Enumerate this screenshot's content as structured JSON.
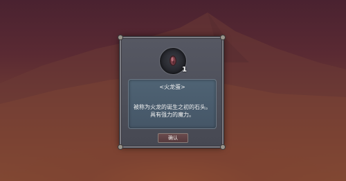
{
  "dialog": {
    "item": {
      "icon": "fire-dragon-egg-stone-icon",
      "count": "1",
      "name": "<火龙蛋>",
      "description_line1": "被称为火龙的诞生之初的石头。",
      "description_line2": "具有强力的魔力。"
    },
    "confirm_label": "确认"
  },
  "colors": {
    "panel": "#4d4f59",
    "description_box": "#4a5d6e",
    "confirm_button": "#5f4245",
    "sky": "#4a2230",
    "horizon_glow": "#a9622f"
  }
}
